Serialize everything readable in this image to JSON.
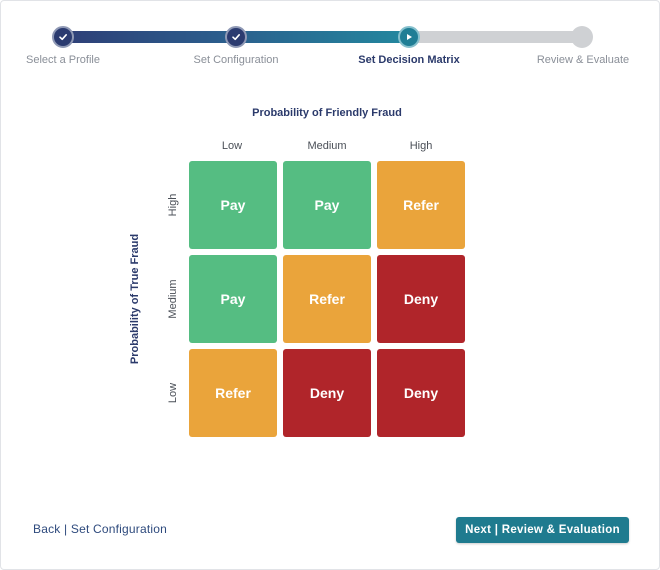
{
  "stepper": {
    "steps": [
      {
        "label": "Select a Profile",
        "state": "done",
        "icon": "check-icon"
      },
      {
        "label": "Set Configuration",
        "state": "done",
        "icon": "check-icon"
      },
      {
        "label": "Set Decision Matrix",
        "state": "current",
        "icon": "play-icon"
      },
      {
        "label": "Review & Evaluate",
        "state": "todo",
        "icon": ""
      }
    ]
  },
  "matrix": {
    "x_title": "Probability of Friendly Fraud",
    "y_title": "Probability of True Fraud",
    "columns": [
      "Low",
      "Medium",
      "High"
    ],
    "rows": [
      {
        "label": "High",
        "cells": [
          "Pay",
          "Pay",
          "Refer"
        ]
      },
      {
        "label": "Medium",
        "cells": [
          "Pay",
          "Refer",
          "Deny"
        ]
      },
      {
        "label": "Low",
        "cells": [
          "Refer",
          "Deny",
          "Deny"
        ]
      }
    ],
    "colors": {
      "Pay": "#55bd82",
      "Refer": "#eaa43b",
      "Deny": "#b0252a"
    }
  },
  "footer": {
    "back_label": "Back | Set Configuration",
    "next_label": "Next | Review & Evaluation"
  }
}
